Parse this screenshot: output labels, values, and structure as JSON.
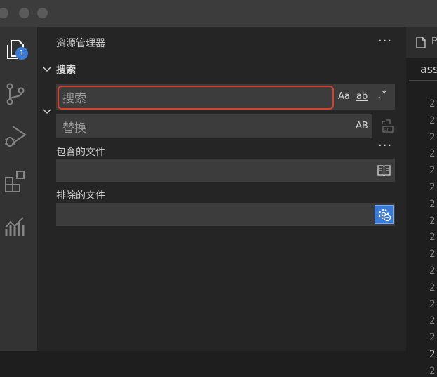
{
  "activity_bar": {
    "explorer_badge": "1"
  },
  "sidebar": {
    "title": "资源管理器",
    "more": "···",
    "search_section": {
      "title": "搜索",
      "search_placeholder": "搜索",
      "options": {
        "match_case": "Aa",
        "whole_word": "ab",
        "regex": ".*"
      },
      "replace_placeholder": "替换",
      "preserve_case": "AB",
      "more": "···",
      "include_label": "包含的文件",
      "exclude_label": "排除的文件"
    }
  },
  "editor": {
    "tab_label": "P",
    "line_text": "ass",
    "line_numbers": [
      "2",
      "2",
      "2",
      "2",
      "2",
      "2",
      "2",
      "2",
      "2",
      "2",
      "2",
      "2",
      "2",
      "2",
      "2",
      "2",
      "2"
    ]
  },
  "colors": {
    "accent_outline": "#d9402b",
    "badge": "#3b7bd8",
    "settings_active": "#3b7bd8"
  }
}
